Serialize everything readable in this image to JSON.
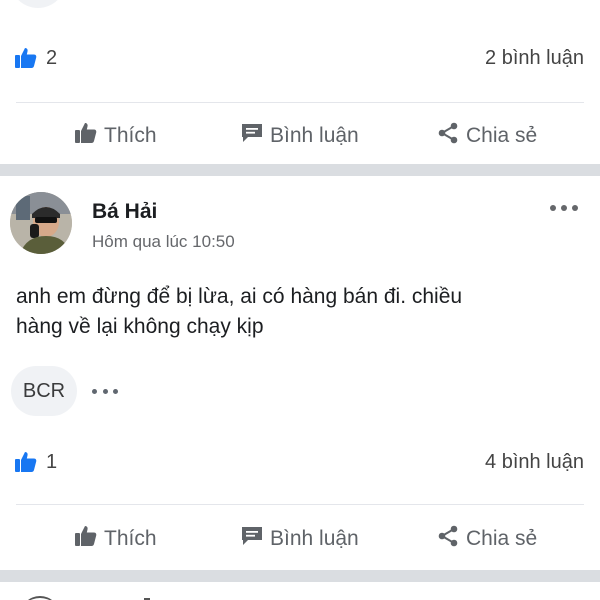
{
  "colors": {
    "like_blue": "#1877f2",
    "text_gray": "#5f6368",
    "separator": "#dadde1"
  },
  "previous_post": {
    "like_count": "2",
    "comment_count": "2 bình luận",
    "actions": {
      "like": "Thích",
      "comment": "Bình luận",
      "share": "Chia sẻ"
    }
  },
  "post": {
    "author": "Bá Hải",
    "time": "Hôm qua lúc 10:50",
    "text_line1": "anh em đừng để bị lừa, ai có hàng bán đi. chiều",
    "text_line2": "hàng về lại không chạy kịp",
    "reaction_chip": "BCR",
    "like_count": "1",
    "comment_count": "4 bình luận",
    "actions": {
      "like": "Thích",
      "comment": "Bình luận",
      "share": "Chia sẻ"
    }
  },
  "icons": {
    "like": "thumbs-up-icon",
    "comment": "comment-icon",
    "share": "share-icon",
    "more": "more-options-icon"
  }
}
